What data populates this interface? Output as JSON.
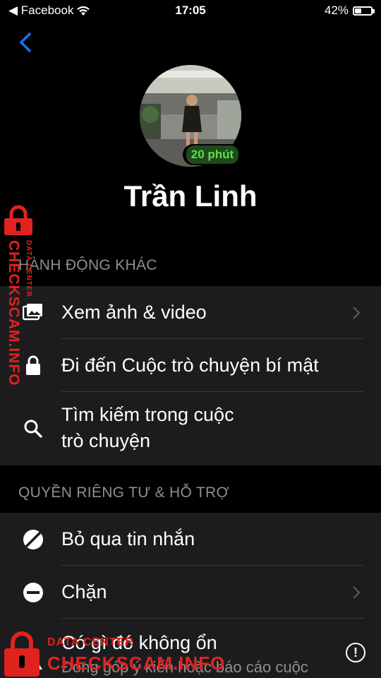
{
  "status_bar": {
    "back_app": "◀ Facebook",
    "time": "17:05",
    "battery": "42%",
    "battery_level": 0.42
  },
  "profile": {
    "name": "Trần Linh",
    "active_badge": "20 phút"
  },
  "sections": {
    "other_actions": {
      "header": "HÀNH ĐỘNG KHÁC",
      "items": [
        {
          "label": "Xem ảnh & video",
          "icon": "photo-icon",
          "chevron": true
        },
        {
          "label": "Đi đến Cuộc trò chuyện bí mật",
          "icon": "lock-icon",
          "chevron": false
        },
        {
          "label_line1": "Tìm kiếm trong cuộc",
          "label_line2": "trò chuyện",
          "icon": "search-icon",
          "chevron": false
        }
      ]
    },
    "privacy_support": {
      "header": "QUYỀN RIÊNG TƯ & HỖ TRỢ",
      "items": [
        {
          "label": "Bỏ qua tin nhắn",
          "icon": "ignore-icon",
          "chevron": false
        },
        {
          "label": "Chặn",
          "icon": "block-icon",
          "chevron": true
        },
        {
          "label": "Có gì đó không ổn",
          "icon": "warning-icon",
          "sublabel": "Đóng góp ý kiến hoặc báo cáo cuộc"
        }
      ]
    }
  },
  "watermark": {
    "side_text": "CHECKSCAM.INFO",
    "side_subtext": "DATA CENTER",
    "bottom_text": "CHECKSCAM.INFO",
    "bottom_subtext": "DATA CENTER",
    "color": "#e0231f"
  },
  "colors": {
    "background": "#000000",
    "group_bg": "#1c1c1e",
    "section_text": "#8e8e93",
    "accent_blue": "#1a73e8",
    "active_green": "#5ce04a"
  }
}
